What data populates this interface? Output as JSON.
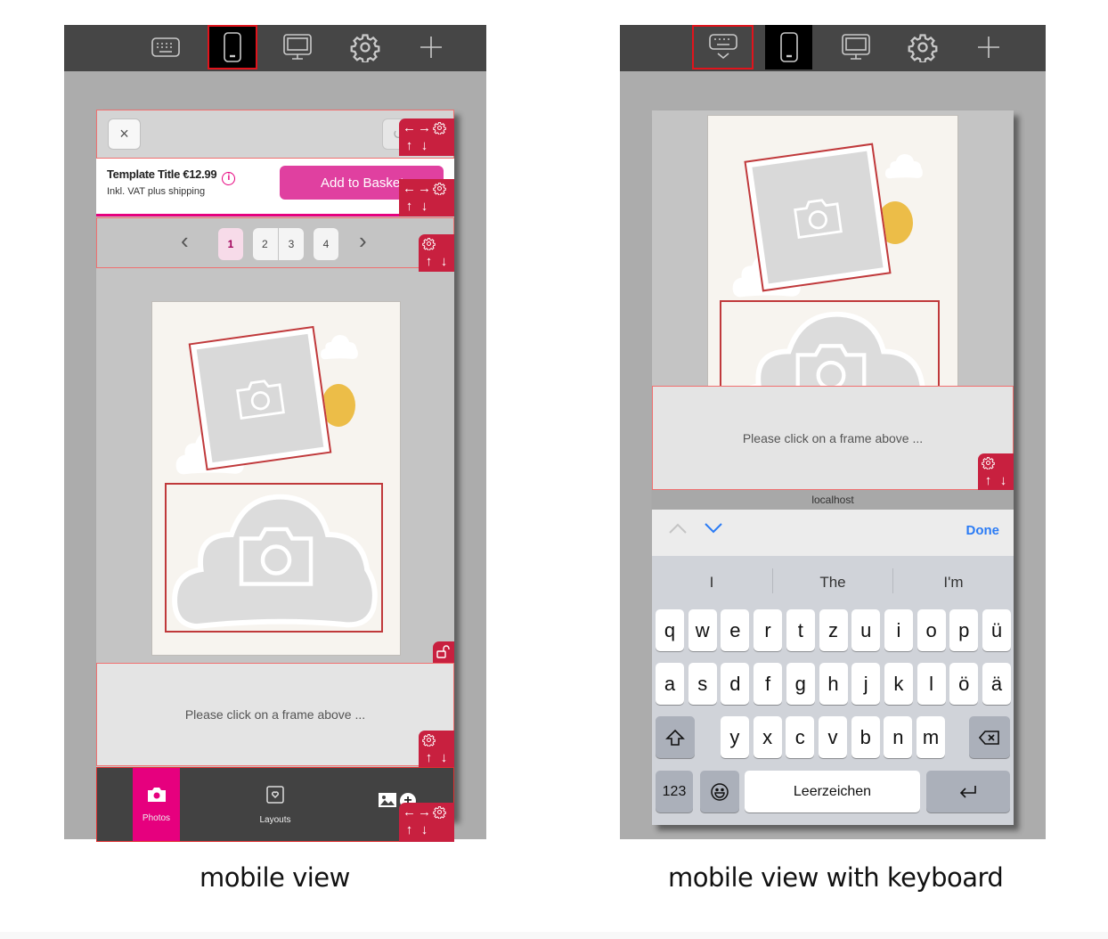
{
  "toolbar": {
    "buttons": [
      {
        "name": "keyboard",
        "icon": "keyboard-icon"
      },
      {
        "name": "mobile",
        "icon": "smartphone-icon"
      },
      {
        "name": "desktop",
        "icon": "monitor-icon"
      },
      {
        "name": "settings",
        "icon": "gear-icon"
      },
      {
        "name": "add",
        "icon": "plus-icon"
      }
    ]
  },
  "mobile_view": {
    "close_icon": "×",
    "undo_icon": "↺",
    "price_title": "Template Title €12.99",
    "info_icon": "i",
    "price_subtitle": "Inkl. VAT plus shipping",
    "add_to_basket": "Add to Basket",
    "pager": {
      "prev": "‹",
      "next": "›",
      "pages": [
        "1",
        "2",
        "3",
        "4"
      ],
      "current_page": "1"
    },
    "hint": "Please click on a frame above ...",
    "nav": {
      "photos": "Photos",
      "layouts": "Layouts"
    }
  },
  "keyboard_view": {
    "hint": "Please click on a frame above ...",
    "address": "localhost",
    "done": "Done",
    "suggestions": [
      "I",
      "The",
      "I'm"
    ],
    "rows": [
      [
        "q",
        "w",
        "e",
        "r",
        "t",
        "z",
        "u",
        "i",
        "o",
        "p",
        "ü"
      ],
      [
        "a",
        "s",
        "d",
        "f",
        "g",
        "h",
        "j",
        "k",
        "l",
        "ö",
        "ä"
      ],
      [
        "y",
        "x",
        "c",
        "v",
        "b",
        "n",
        "m"
      ]
    ],
    "numbers_key": "123",
    "space_key": "Leerzeichen"
  },
  "controls": {
    "left": "←",
    "right": "→",
    "up": "↑",
    "down": "↓"
  },
  "captions": {
    "left": "mobile view",
    "right": "mobile view with keyboard"
  },
  "colors": {
    "accent": "#e6007e",
    "control_panel": "#c8203f",
    "frame_outline": "#c0393b",
    "ios_blue": "#2a7bf5"
  }
}
